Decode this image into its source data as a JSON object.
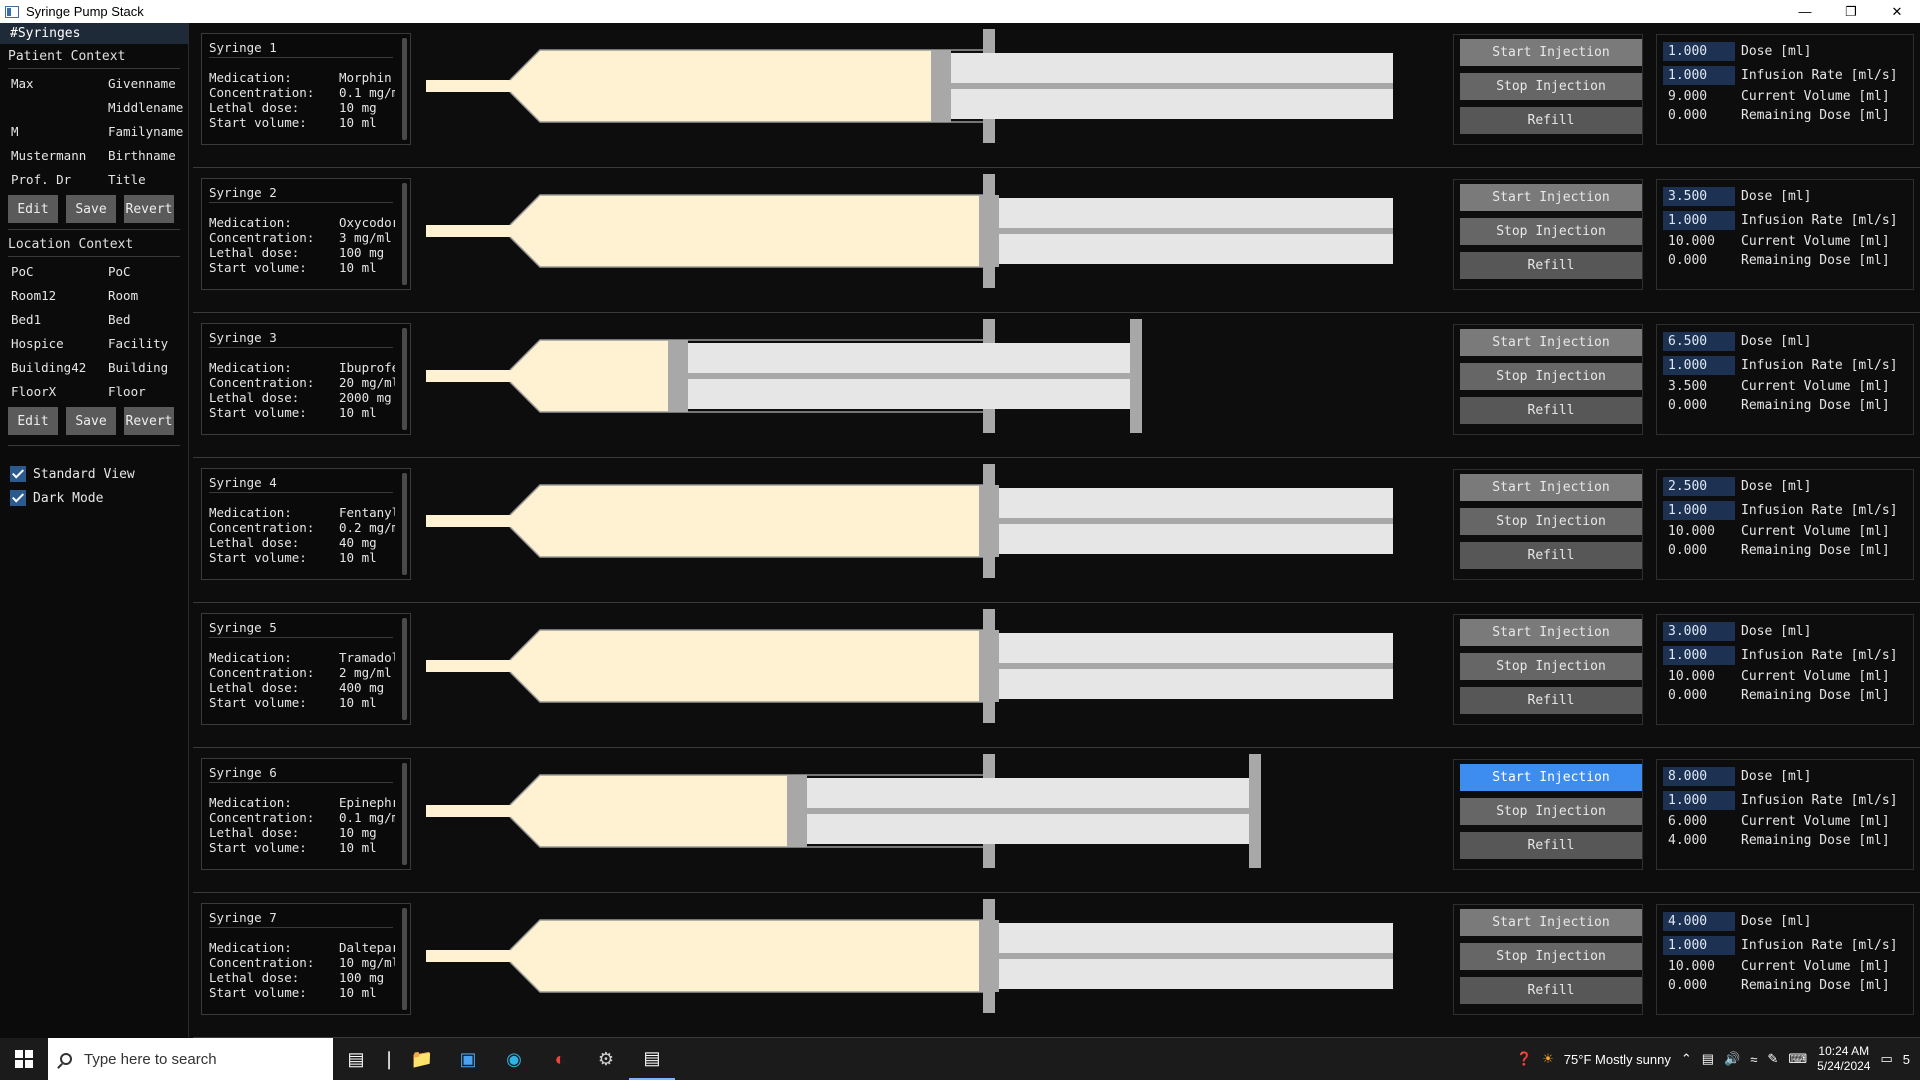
{
  "window": {
    "title": "Syringe Pump Stack"
  },
  "sidebar": {
    "header": "#Syringes",
    "patient_title": "Patient Context",
    "patient": [
      {
        "value": "Max",
        "key": "Givenname"
      },
      {
        "value": "",
        "key": "Middlename"
      },
      {
        "value": "M",
        "key": "Familyname"
      },
      {
        "value": "Mustermann",
        "key": "Birthname"
      },
      {
        "value": "Prof. Dr",
        "key": "Title"
      }
    ],
    "location_title": "Location Context",
    "location": [
      {
        "value": "PoC",
        "key": "PoC"
      },
      {
        "value": "Room12",
        "key": "Room"
      },
      {
        "value": "Bed1",
        "key": "Bed"
      },
      {
        "value": "Hospice",
        "key": "Facility"
      },
      {
        "value": "Building42",
        "key": "Building"
      },
      {
        "value": "FloorX",
        "key": "Floor"
      }
    ],
    "buttons": {
      "edit": "Edit",
      "save": "Save",
      "revert": "Revert"
    },
    "standard_view": "Standard View",
    "dark_mode": "Dark Mode"
  },
  "labels": {
    "medication": "Medication:",
    "concentration": "Concentration:",
    "lethal": "Lethal dose:",
    "start_volume": "Start volume:",
    "start": "Start Injection",
    "stop": "Stop Injection",
    "refill": "Refill",
    "dose": "Dose [ml]",
    "rate": "Infusion Rate [ml/s]",
    "current": "Current Volume [ml]",
    "remaining": "Remaining Dose [ml]"
  },
  "syringes": [
    {
      "name": "Syringe 1",
      "medication": "Morphin",
      "concentration": "0.1 mg/m",
      "lethal": "10 mg",
      "start_volume": "10 ml",
      "dose": "1.000",
      "rate": "1.000",
      "current": "9.000",
      "remaining": "0.000",
      "fill_fraction": 0.9,
      "active": false
    },
    {
      "name": "Syringe 2",
      "medication": "Oxycodor",
      "concentration": "3 mg/ml",
      "lethal": "100 mg",
      "start_volume": "10 ml",
      "dose": "3.500",
      "rate": "1.000",
      "current": "10.000",
      "remaining": "0.000",
      "fill_fraction": 1.0,
      "active": false
    },
    {
      "name": "Syringe 3",
      "medication": "Ibuprofe",
      "concentration": "20 mg/ml",
      "lethal": "2000 mg",
      "start_volume": "10 ml",
      "dose": "6.500",
      "rate": "1.000",
      "current": "3.500",
      "remaining": "0.000",
      "fill_fraction": 0.35,
      "active": false
    },
    {
      "name": "Syringe 4",
      "medication": "Fentanyl",
      "concentration": "0.2 mg/m",
      "lethal": "40 mg",
      "start_volume": "10 ml",
      "dose": "2.500",
      "rate": "1.000",
      "current": "10.000",
      "remaining": "0.000",
      "fill_fraction": 1.0,
      "active": false
    },
    {
      "name": "Syringe 5",
      "medication": "Tramadol",
      "concentration": "2 mg/ml",
      "lethal": "400 mg",
      "start_volume": "10 ml",
      "dose": "3.000",
      "rate": "1.000",
      "current": "10.000",
      "remaining": "0.000",
      "fill_fraction": 1.0,
      "active": false
    },
    {
      "name": "Syringe 6",
      "medication": "Epinephr",
      "concentration": "0.1 mg/m",
      "lethal": "10 mg",
      "start_volume": "10 ml",
      "dose": "8.000",
      "rate": "1.000",
      "current": "6.000",
      "remaining": "4.000",
      "fill_fraction": 0.6,
      "active": true
    },
    {
      "name": "Syringe 7",
      "medication": "Daltepar",
      "concentration": "10 mg/ml",
      "lethal": "100 mg",
      "start_volume": "10 ml",
      "dose": "4.000",
      "rate": "1.000",
      "current": "10.000",
      "remaining": "0.000",
      "fill_fraction": 1.0,
      "active": false
    }
  ],
  "taskbar": {
    "search_placeholder": "Type here to search",
    "weather": "75°F  Mostly sunny",
    "time": "10:24 AM",
    "date": "5/24/2024",
    "notifications": "5"
  },
  "colors": {
    "liquid": "#fff2d2",
    "barrel": "#e6e6e6",
    "plunger": "#a8a8a8",
    "accent": "#3d8cf0"
  }
}
